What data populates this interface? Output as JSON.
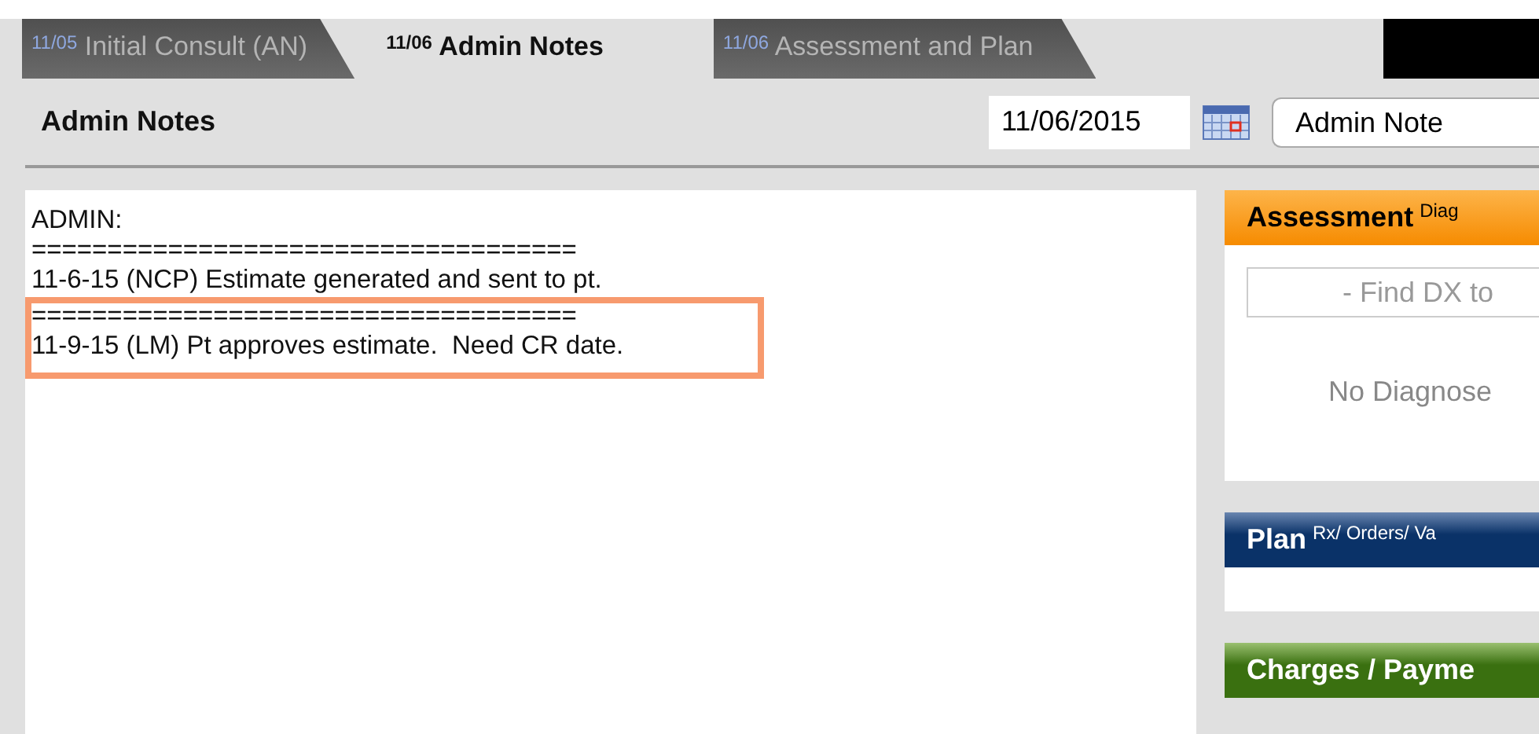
{
  "tabs": [
    {
      "date": "11/05",
      "label": "Initial Consult (AN)",
      "selected": false
    },
    {
      "date": "11/06",
      "label": "Admin Notes",
      "selected": true
    },
    {
      "date": "11/06",
      "label": "Assessment and Plan",
      "selected": false
    }
  ],
  "header": {
    "title": "Admin Notes",
    "date": "11/06/2015",
    "note_type": "Admin Note"
  },
  "notes": [
    {
      "highlighted": false,
      "lines": [
        "ADMIN:",
        "====================================",
        "11-6-15 (NCP) Estimate generated and sent to pt."
      ]
    },
    {
      "highlighted": true,
      "lines": [
        "====================================",
        "11-9-15 (LM) Pt approves estimate.  Need CR date."
      ]
    }
  ],
  "panels": [
    {
      "kind": "assessment",
      "title": "Assessment",
      "subtitle": "Diag",
      "search_placeholder": "- Find DX to",
      "empty_text": "No Diagnose"
    },
    {
      "kind": "plan",
      "title": "Plan",
      "subtitle": "Rx/ Orders/ Va"
    },
    {
      "kind": "charges",
      "title": "Charges / Payme"
    }
  ]
}
